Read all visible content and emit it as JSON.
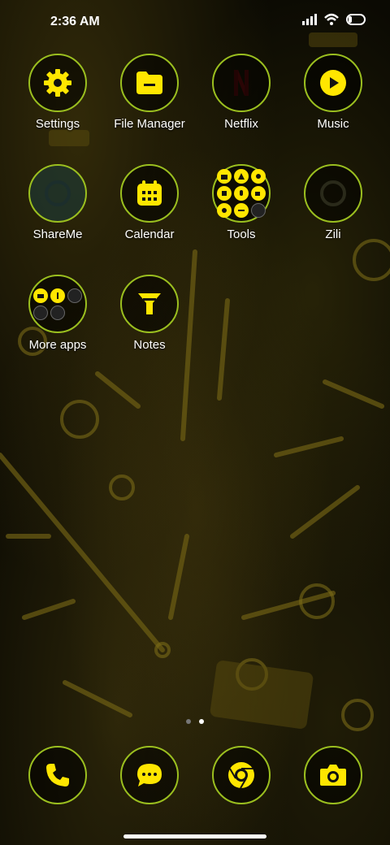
{
  "status_bar": {
    "time": "2:36 AM"
  },
  "home": {
    "apps": [
      {
        "label": "Settings",
        "icon": "gear-icon"
      },
      {
        "label": "File Manager",
        "icon": "folder-icon"
      },
      {
        "label": "Netflix",
        "icon": "netflix-icon"
      },
      {
        "label": "Music",
        "icon": "play-icon"
      },
      {
        "label": "ShareMe",
        "icon": "shareme-icon"
      },
      {
        "label": "Calendar",
        "icon": "calendar-icon"
      },
      {
        "label": "Tools",
        "icon": "tools-folder-icon"
      },
      {
        "label": "Zili",
        "icon": "zili-icon"
      },
      {
        "label": "More apps",
        "icon": "more-apps-folder-icon"
      },
      {
        "label": "Notes",
        "icon": "notes-icon"
      }
    ]
  },
  "dock": [
    {
      "name": "Phone",
      "icon": "phone-icon"
    },
    {
      "name": "Messages",
      "icon": "message-icon"
    },
    {
      "name": "Chrome",
      "icon": "chrome-icon"
    },
    {
      "name": "Camera",
      "icon": "camera-icon"
    }
  ],
  "theme": {
    "accent": "#ffe600",
    "ring": "#9bbf1f"
  }
}
